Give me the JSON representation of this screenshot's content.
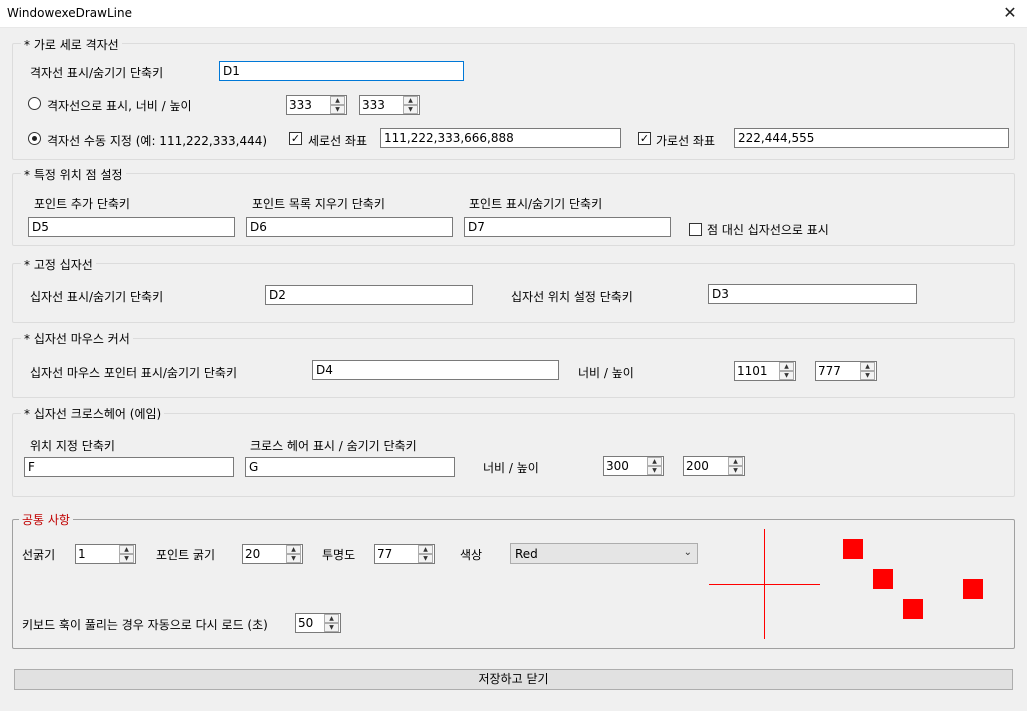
{
  "window": {
    "title": "WindowexeDrawLine",
    "close_glyph": "✕"
  },
  "grid": {
    "title": "* 가로 세로 격자선",
    "toggle_label": "격자선 표시/숨기기 단축키",
    "toggle_value": "D1",
    "auto_label": "격자선으로 표시, 너비 / 높이",
    "auto_width": "333",
    "auto_height": "333",
    "manual_label": "격자선 수동 지정 (예: 111,222,333,444)",
    "vertical_label": "세로선 좌표",
    "vertical_value": "111,222,333,666,888",
    "horizontal_label": "가로선 좌표",
    "horizontal_value": "222,444,555"
  },
  "points": {
    "title": "* 특정 위치 점 설정",
    "add_label": "포인트 추가 단축키",
    "add_value": "D5",
    "clear_label": "포인트 목록 지우기 단축키",
    "clear_value": "D6",
    "toggle_label": "포인트 표시/숨기기 단축키",
    "toggle_value": "D7",
    "cross_label": "점 대신 십자선으로 표시"
  },
  "fixed_cross": {
    "title": "* 고정 십자선",
    "toggle_label": "십자선 표시/숨기기 단축키",
    "toggle_value": "D2",
    "position_label": "십자선 위치 설정 단축키",
    "position_value": "D3"
  },
  "mouse_cross": {
    "title": "* 십자선 마우스 커서",
    "toggle_label": "십자선 마우스 포인터 표시/숨기기 단축키",
    "toggle_value": "D4",
    "size_label": "너비 / 높이",
    "width": "1101",
    "height": "777"
  },
  "crosshair": {
    "title": "* 십자선 크로스헤어 (에임)",
    "position_label": "위치 지정 단축키",
    "position_value": "F",
    "toggle_label": "크로스 헤어 표시 / 숨기기 단축키",
    "toggle_value": "G",
    "size_label": "너비 / 높이",
    "width": "300",
    "height": "200"
  },
  "common": {
    "title": "공통 사항",
    "title_color": "#c00000",
    "line_width_label": "선굵기",
    "line_width": "1",
    "point_width_label": "포인트 굵기",
    "point_width": "20",
    "opacity_label": "투명도",
    "opacity": "77",
    "color_label": "색상",
    "color_value": "Red",
    "reload_label": "키보드 훅이 풀리는 경우 자동으로 다시 로드 (초)",
    "reload_value": "50",
    "preview_color": "#ff0000"
  },
  "save_button": "저장하고 닫기"
}
